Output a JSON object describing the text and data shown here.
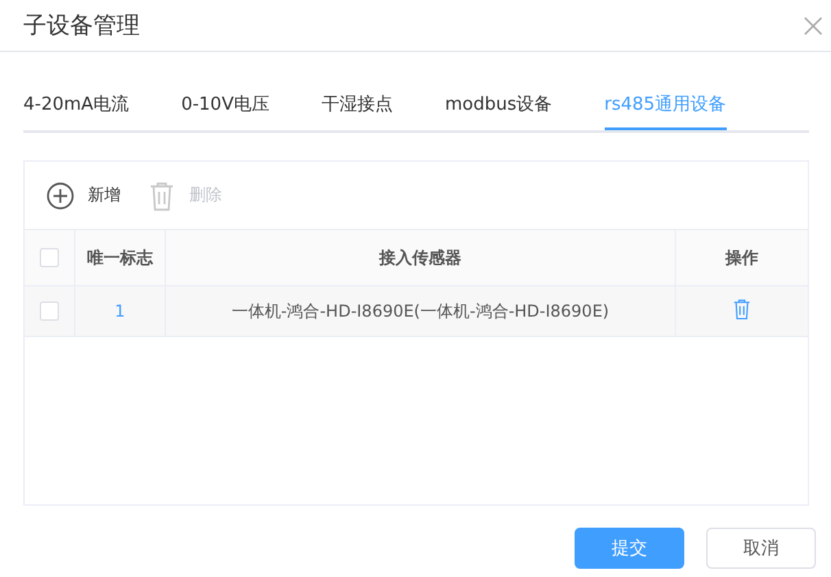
{
  "window": {
    "title": "子设备管理"
  },
  "tabs": [
    {
      "label": "4-20mA电流",
      "selected": false
    },
    {
      "label": "0-10V电压",
      "selected": false
    },
    {
      "label": "干湿接点",
      "selected": false
    },
    {
      "label": "modbus设备",
      "selected": false
    },
    {
      "label": "rs485通用设备",
      "selected": true
    }
  ],
  "toolbar": [
    {
      "label": "新增",
      "kind": "add",
      "disabled": false
    },
    {
      "label": "删除",
      "kind": "delete",
      "disabled": true
    }
  ],
  "table": {
    "header_checked": false,
    "columns": [
      "唯一标志",
      "接入传感器",
      "操作"
    ],
    "rows": [
      {
        "checked": false,
        "id": "1",
        "sensor": "一体机-鸿合-HD-I8690E(一体机-鸿合-HD-I8690E)"
      }
    ]
  },
  "buttons": [
    {
      "label": "提交",
      "kind": "primary"
    },
    {
      "label": "取消",
      "kind": "default"
    }
  ]
}
